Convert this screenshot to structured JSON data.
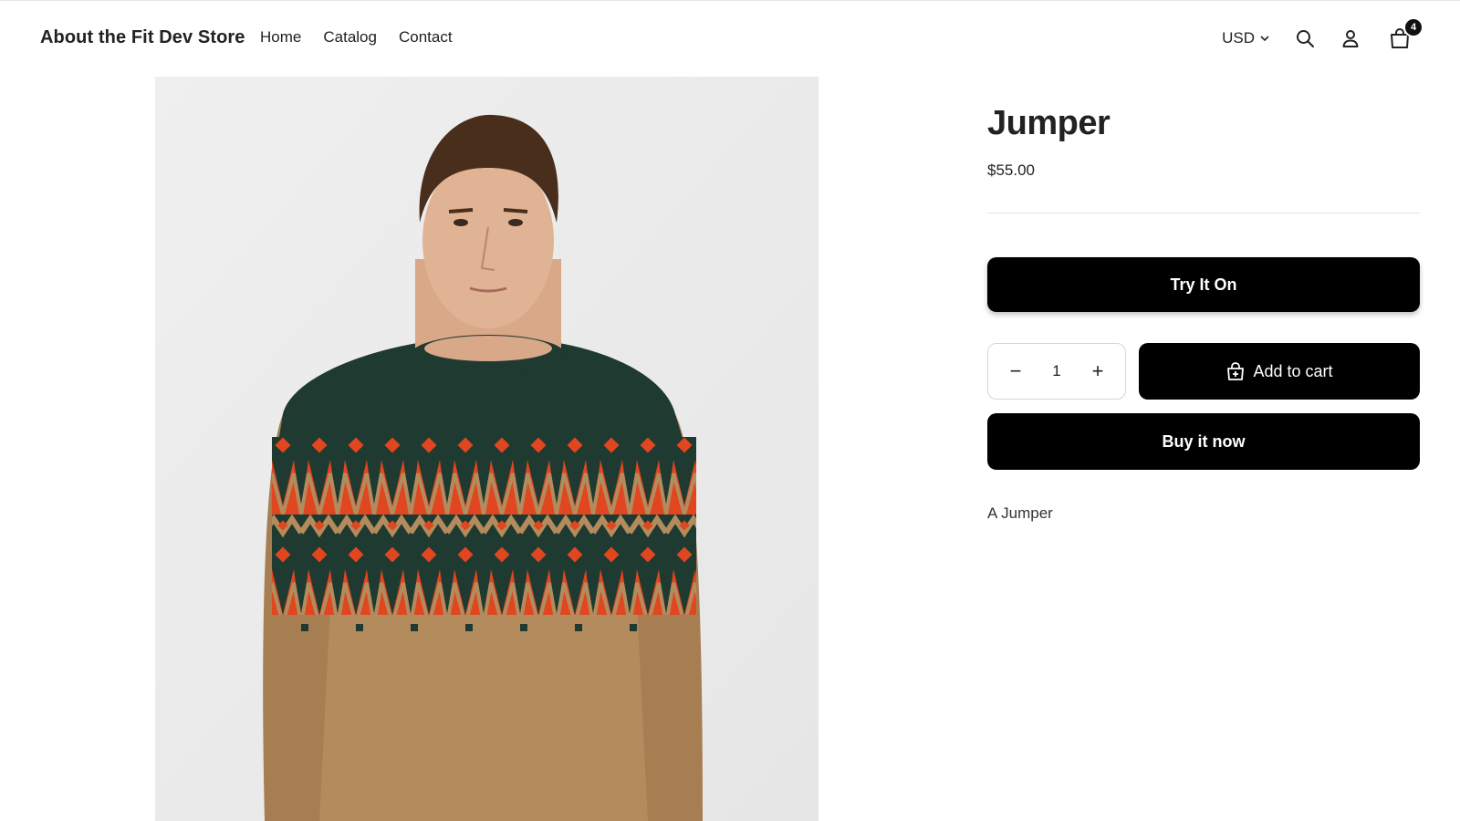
{
  "header": {
    "brand": "About the Fit Dev Store",
    "nav": [
      {
        "label": "Home"
      },
      {
        "label": "Catalog"
      },
      {
        "label": "Contact"
      }
    ],
    "currency": "USD",
    "cart_count": "4",
    "icons": [
      "chevron-down-icon",
      "search-icon",
      "account-icon",
      "cart-icon"
    ]
  },
  "product": {
    "title": "Jumper",
    "price": "$55.00",
    "try_on_label": "Try It On",
    "quantity": "1",
    "add_to_cart_label": "Add to cart",
    "buy_now_label": "Buy it now",
    "description": "A Jumper",
    "image_alt": "Man wearing a green, orange and tan Fair Isle knit jumper"
  },
  "colors": {
    "button_bg": "#000000",
    "button_text": "#ffffff",
    "sweater_green": "#1f3a30",
    "sweater_tan": "#b48b5c",
    "sweater_orange": "#e0461f"
  }
}
